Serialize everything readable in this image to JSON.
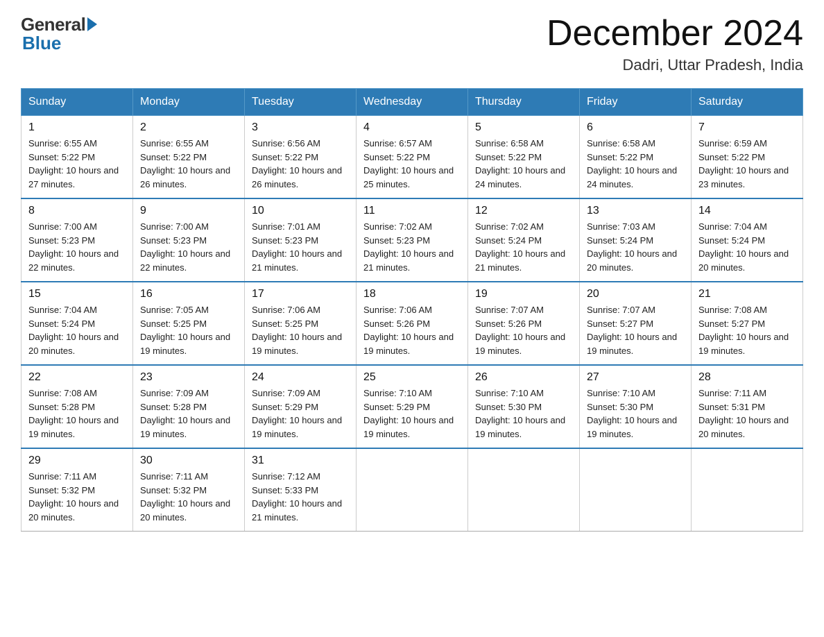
{
  "header": {
    "logo_general": "General",
    "logo_blue": "Blue",
    "month_title": "December 2024",
    "location": "Dadri, Uttar Pradesh, India"
  },
  "weekdays": [
    "Sunday",
    "Monday",
    "Tuesday",
    "Wednesday",
    "Thursday",
    "Friday",
    "Saturday"
  ],
  "weeks": [
    [
      {
        "day": "1",
        "sunrise": "6:55 AM",
        "sunset": "5:22 PM",
        "daylight": "10 hours and 27 minutes."
      },
      {
        "day": "2",
        "sunrise": "6:55 AM",
        "sunset": "5:22 PM",
        "daylight": "10 hours and 26 minutes."
      },
      {
        "day": "3",
        "sunrise": "6:56 AM",
        "sunset": "5:22 PM",
        "daylight": "10 hours and 26 minutes."
      },
      {
        "day": "4",
        "sunrise": "6:57 AM",
        "sunset": "5:22 PM",
        "daylight": "10 hours and 25 minutes."
      },
      {
        "day": "5",
        "sunrise": "6:58 AM",
        "sunset": "5:22 PM",
        "daylight": "10 hours and 24 minutes."
      },
      {
        "day": "6",
        "sunrise": "6:58 AM",
        "sunset": "5:22 PM",
        "daylight": "10 hours and 24 minutes."
      },
      {
        "day": "7",
        "sunrise": "6:59 AM",
        "sunset": "5:22 PM",
        "daylight": "10 hours and 23 minutes."
      }
    ],
    [
      {
        "day": "8",
        "sunrise": "7:00 AM",
        "sunset": "5:23 PM",
        "daylight": "10 hours and 22 minutes."
      },
      {
        "day": "9",
        "sunrise": "7:00 AM",
        "sunset": "5:23 PM",
        "daylight": "10 hours and 22 minutes."
      },
      {
        "day": "10",
        "sunrise": "7:01 AM",
        "sunset": "5:23 PM",
        "daylight": "10 hours and 21 minutes."
      },
      {
        "day": "11",
        "sunrise": "7:02 AM",
        "sunset": "5:23 PM",
        "daylight": "10 hours and 21 minutes."
      },
      {
        "day": "12",
        "sunrise": "7:02 AM",
        "sunset": "5:24 PM",
        "daylight": "10 hours and 21 minutes."
      },
      {
        "day": "13",
        "sunrise": "7:03 AM",
        "sunset": "5:24 PM",
        "daylight": "10 hours and 20 minutes."
      },
      {
        "day": "14",
        "sunrise": "7:04 AM",
        "sunset": "5:24 PM",
        "daylight": "10 hours and 20 minutes."
      }
    ],
    [
      {
        "day": "15",
        "sunrise": "7:04 AM",
        "sunset": "5:24 PM",
        "daylight": "10 hours and 20 minutes."
      },
      {
        "day": "16",
        "sunrise": "7:05 AM",
        "sunset": "5:25 PM",
        "daylight": "10 hours and 19 minutes."
      },
      {
        "day": "17",
        "sunrise": "7:06 AM",
        "sunset": "5:25 PM",
        "daylight": "10 hours and 19 minutes."
      },
      {
        "day": "18",
        "sunrise": "7:06 AM",
        "sunset": "5:26 PM",
        "daylight": "10 hours and 19 minutes."
      },
      {
        "day": "19",
        "sunrise": "7:07 AM",
        "sunset": "5:26 PM",
        "daylight": "10 hours and 19 minutes."
      },
      {
        "day": "20",
        "sunrise": "7:07 AM",
        "sunset": "5:27 PM",
        "daylight": "10 hours and 19 minutes."
      },
      {
        "day": "21",
        "sunrise": "7:08 AM",
        "sunset": "5:27 PM",
        "daylight": "10 hours and 19 minutes."
      }
    ],
    [
      {
        "day": "22",
        "sunrise": "7:08 AM",
        "sunset": "5:28 PM",
        "daylight": "10 hours and 19 minutes."
      },
      {
        "day": "23",
        "sunrise": "7:09 AM",
        "sunset": "5:28 PM",
        "daylight": "10 hours and 19 minutes."
      },
      {
        "day": "24",
        "sunrise": "7:09 AM",
        "sunset": "5:29 PM",
        "daylight": "10 hours and 19 minutes."
      },
      {
        "day": "25",
        "sunrise": "7:10 AM",
        "sunset": "5:29 PM",
        "daylight": "10 hours and 19 minutes."
      },
      {
        "day": "26",
        "sunrise": "7:10 AM",
        "sunset": "5:30 PM",
        "daylight": "10 hours and 19 minutes."
      },
      {
        "day": "27",
        "sunrise": "7:10 AM",
        "sunset": "5:30 PM",
        "daylight": "10 hours and 19 minutes."
      },
      {
        "day": "28",
        "sunrise": "7:11 AM",
        "sunset": "5:31 PM",
        "daylight": "10 hours and 20 minutes."
      }
    ],
    [
      {
        "day": "29",
        "sunrise": "7:11 AM",
        "sunset": "5:32 PM",
        "daylight": "10 hours and 20 minutes."
      },
      {
        "day": "30",
        "sunrise": "7:11 AM",
        "sunset": "5:32 PM",
        "daylight": "10 hours and 20 minutes."
      },
      {
        "day": "31",
        "sunrise": "7:12 AM",
        "sunset": "5:33 PM",
        "daylight": "10 hours and 21 minutes."
      },
      null,
      null,
      null,
      null
    ]
  ],
  "labels": {
    "sunrise": "Sunrise: ",
    "sunset": "Sunset: ",
    "daylight": "Daylight: "
  }
}
